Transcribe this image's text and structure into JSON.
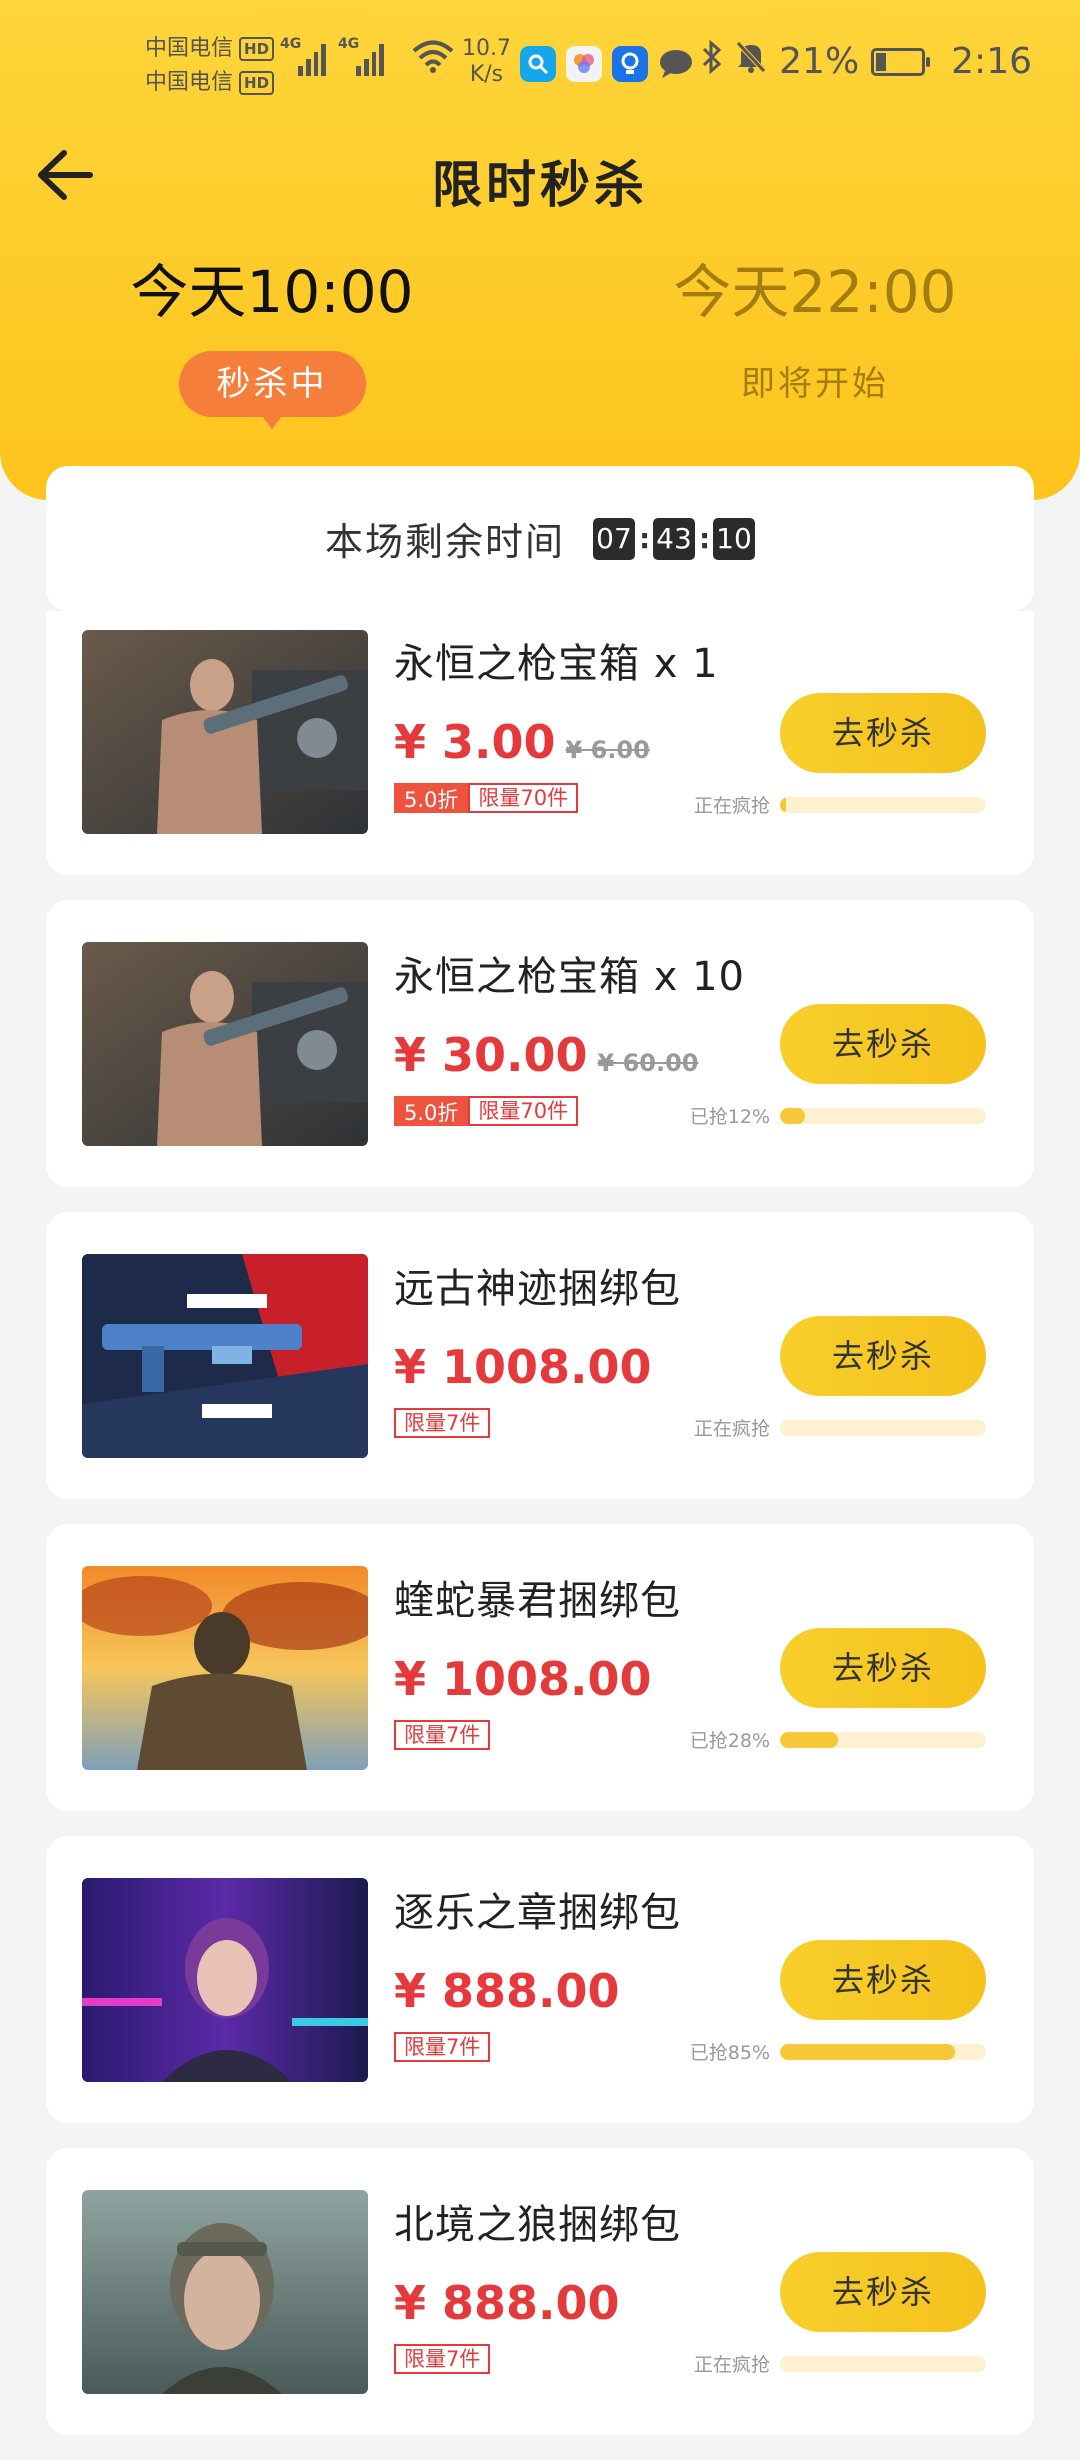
{
  "status_bar": {
    "carrier_1": "中国电信",
    "carrier_2": "中国电信",
    "hd": "HD",
    "network": "4G",
    "net_speed_value": "10.7",
    "net_speed_unit": "K/s",
    "battery_text": "21%",
    "clock": "2:16",
    "icons": [
      "search-app-icon",
      "photos-app-icon",
      "tips-app-icon",
      "message-app-icon",
      "bluetooth-icon",
      "mute-icon",
      "battery-icon"
    ]
  },
  "header": {
    "title": "限时秒杀",
    "back_icon": "arrow-left-icon"
  },
  "sessions": [
    {
      "time": "今天10:00",
      "status": "秒杀中",
      "active": true
    },
    {
      "time": "今天22:00",
      "status": "即将开始",
      "active": false
    }
  ],
  "countdown": {
    "label": "本场剩余时间",
    "hours": "07",
    "minutes": "43",
    "seconds": "10"
  },
  "colors": {
    "header_yellow": "#fdc41c",
    "active_pill": "#f47e3a",
    "price_red": "#e5393c",
    "button_yellow": "#f6c737"
  },
  "products": [
    {
      "name": "永恒之枪宝箱 x 1",
      "price": "¥ 3.00",
      "original_price": "¥ 6.00",
      "discount": "5.0折",
      "limit": "限量70件",
      "button": "去秒杀",
      "progress_label": "正在疯抢",
      "progress": 0.03,
      "image": "soldier-with-gun-image"
    },
    {
      "name": "永恒之枪宝箱 x 10",
      "price": "¥ 30.00",
      "original_price": "¥ 60.00",
      "discount": "5.0折",
      "limit": "限量70件",
      "button": "去秒杀",
      "progress_label": "已抢12%",
      "progress": 0.12,
      "image": "soldier-with-gun-image"
    },
    {
      "name": "远古神迹捆绑包",
      "price": "¥ 1008.00",
      "limit": "限量7件",
      "button": "去秒杀",
      "progress_label": "正在疯抢",
      "progress": 0,
      "image": "ancient-relic-weapon-image"
    },
    {
      "name": "蝰蛇暴君捆绑包",
      "price": "¥ 1008.00",
      "limit": "限量7件",
      "button": "去秒杀",
      "progress_label": "已抢28%",
      "progress": 0.28,
      "image": "viper-tyrant-soldier-image"
    },
    {
      "name": "逐乐之章捆绑包",
      "price": "¥ 888.00",
      "limit": "限量7件",
      "button": "去秒杀",
      "progress_label": "已抢85%",
      "progress": 0.85,
      "image": "music-chapter-girl-image"
    },
    {
      "name": "北境之狼捆绑包",
      "price": "¥ 888.00",
      "limit": "限量7件",
      "button": "去秒杀",
      "progress_label": "正在疯抢",
      "progress": 0,
      "image": "northern-wolf-woman-image"
    }
  ]
}
